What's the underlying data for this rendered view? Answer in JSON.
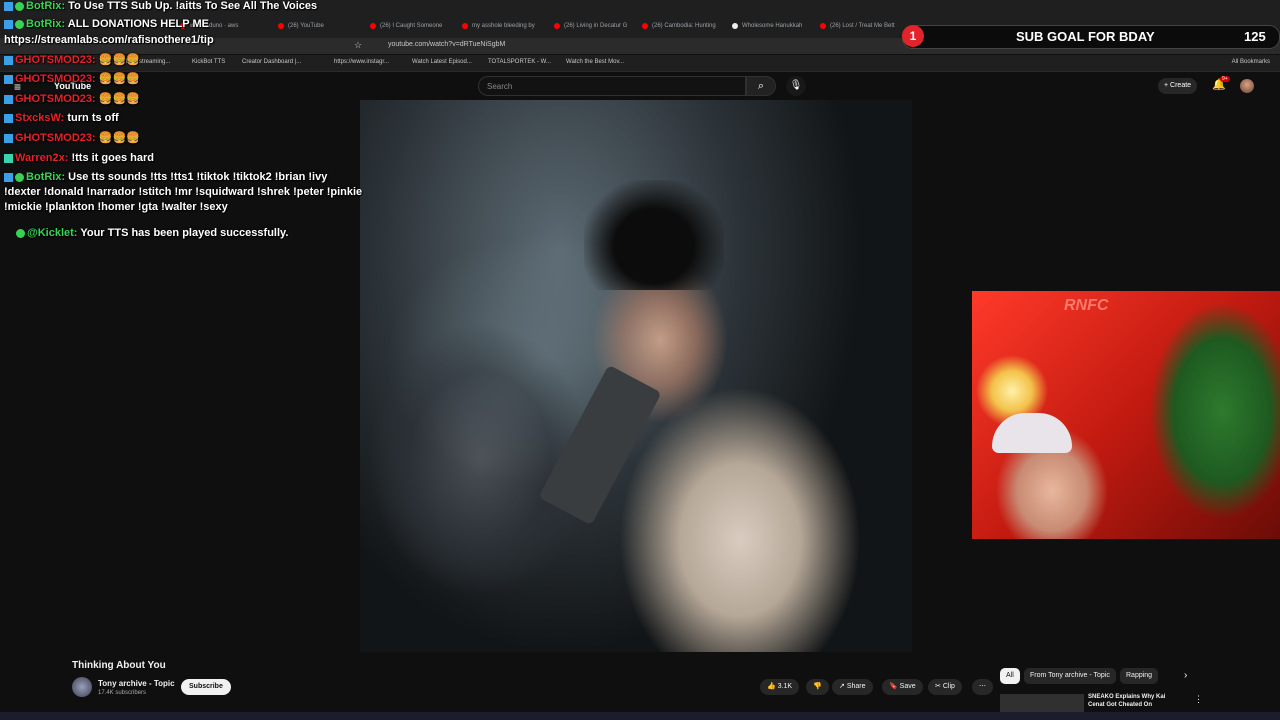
{
  "browser": {
    "tabs": [
      "wiatkarduno · aws",
      "(26) YouTube",
      "(26) I Caught Someone",
      "my asshole bleeding by",
      "(26) Living in Decatur G",
      "(26) Cambodia: Hunting",
      "Wholesome Hanukkah",
      "(26) Lost / Treat Me Bett"
    ],
    "url": "youtube.com/watch?v=dRTueNiSgbM",
    "bookmarks": [
      "best streaming...",
      "KickBot TTS",
      "Creator Dashboard |...",
      "https://www.instagr...",
      "Watch Latest Episod...",
      "TOTALSPORTEK - W...",
      "Watch the Best Mov..."
    ],
    "all_bookmarks": "All Bookmarks"
  },
  "youtube": {
    "logo": "YouTube",
    "search_placeholder": "Search",
    "create_label": "Create",
    "notif_badge": "9+",
    "video_title": "Thinking About You",
    "channel_name": "Tony archive - Topic",
    "channel_subs": "17.4K subscribers",
    "subscribe_label": "Subscribe",
    "actions": {
      "likes": "3.1K",
      "share": "Share",
      "save": "Save",
      "clip": "Clip",
      "more": "⋯"
    },
    "chips": [
      "All",
      "From Tony archive - Topic",
      "Rapping"
    ],
    "rec_title_1": "SNEAKO Explains Why Kai",
    "rec_title_2": "Cenat Got Cheated On"
  },
  "subgoal": {
    "number": "1",
    "label": "SUB GOAL FOR BDAY",
    "count": "125"
  },
  "webcam": {
    "logo": "RNFC"
  },
  "chat": [
    {
      "name": "BotRix:",
      "text": "To Use TTS Sub Up. !aitts To See All The Voices",
      "color": "green"
    },
    {
      "name": "BotRix:",
      "text": "ALL DONATIONS HELP ME",
      "color": "green"
    },
    {
      "name": "",
      "text": "https://streamlabs.com/rafisnothere1/tip",
      "color": "white"
    },
    {
      "name": "GHOTSMOD23:",
      "text": "🍔🍔🍔",
      "color": "red"
    },
    {
      "name": "GHOTSMOD23:",
      "text": "🍔🍔🍔",
      "color": "red"
    },
    {
      "name": "GHOTSMOD23:",
      "text": "🍔🍔🍔",
      "color": "red"
    },
    {
      "name": "StxcksW:",
      "text": "turn ts off",
      "color": "red"
    },
    {
      "name": "GHOTSMOD23:",
      "text": "🍔🍔🍔",
      "color": "red"
    },
    {
      "name": "Warren2x:",
      "text": "!tts it goes hard",
      "color": "red"
    },
    {
      "name": "BotRix:",
      "text": "Use tts sounds !tts !tts1 !tiktok !tiktok2 !brian !ivy",
      "color": "green"
    },
    {
      "name": "",
      "text": "!dexter !donald !narrador !stitch !mr !squidward !shrek !peter !pinkie",
      "color": "white"
    },
    {
      "name": "",
      "text": "!mickie !plankton !homer !gta !walter !sexy",
      "color": "white"
    },
    {
      "name": "@Kicklet:",
      "text": "Your TTS has been played successfully.",
      "color": "green"
    }
  ]
}
